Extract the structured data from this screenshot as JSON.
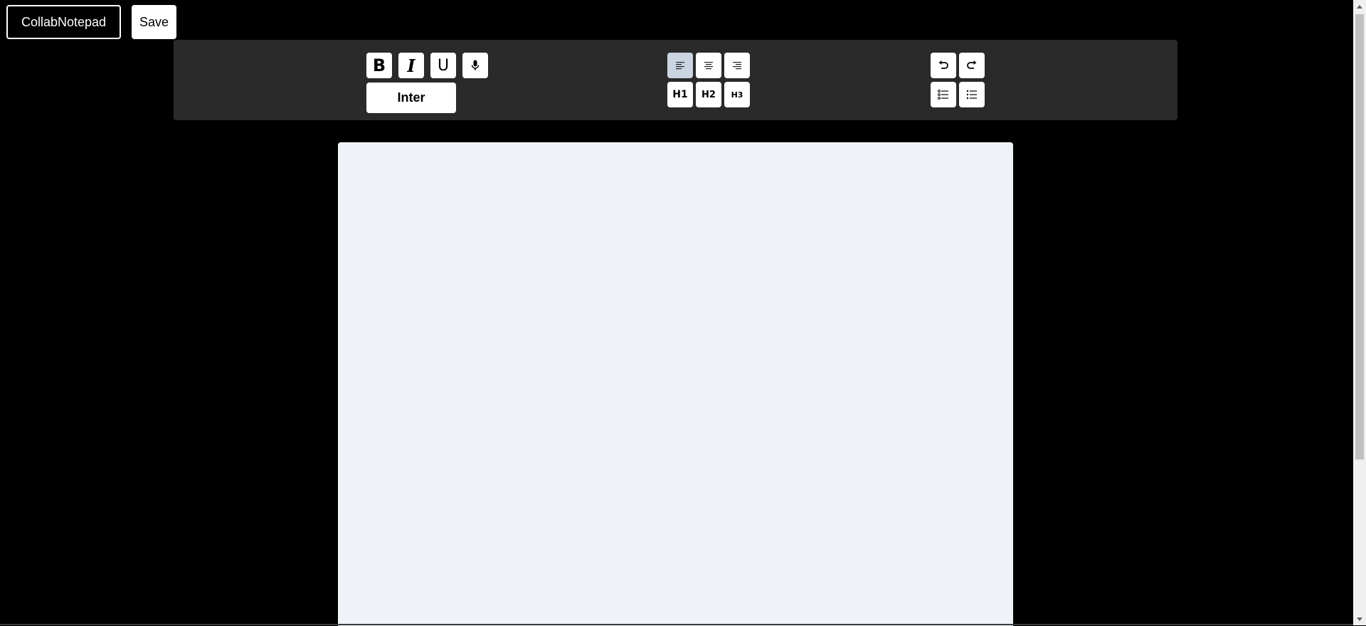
{
  "header": {
    "app_title": "CollabNotepad",
    "save_label": "Save"
  },
  "toolbar": {
    "format": {
      "bold_label": "B",
      "italic_label": "I",
      "underline_label": "U",
      "mic_icon": "microphone-icon",
      "font_label": "Inter"
    },
    "align": {
      "left_icon": "align-left-icon",
      "center_icon": "align-center-icon",
      "right_icon": "align-right-icon",
      "active": "left"
    },
    "headings": {
      "h1_label": "H1",
      "h2_label": "H2",
      "h3_label": "H3"
    },
    "history": {
      "undo_icon": "undo-icon",
      "redo_icon": "redo-icon",
      "ordered_list_icon": "ordered-list-icon",
      "bullet_list_icon": "bullet-list-icon"
    }
  },
  "editor": {
    "content": ""
  },
  "colors": {
    "page_bg": "#000000",
    "toolbar_bg": "#2a2a2a",
    "button_bg": "#ffffff",
    "active_button_bg": "#cbd5e1",
    "editor_bg": "#eff3f8"
  }
}
